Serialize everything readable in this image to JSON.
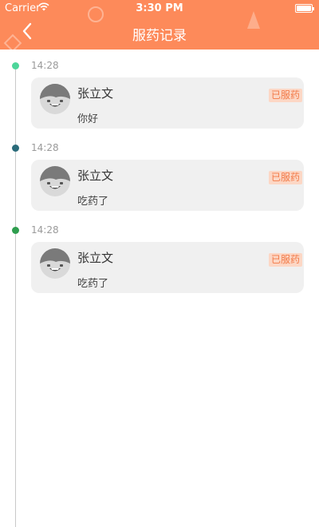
{
  "status_bar": {
    "carrier": "Carrier",
    "time": "3:30 PM",
    "battery_level": 1.0
  },
  "header": {
    "title": "服药记录",
    "back_icon": "chevron-left-icon"
  },
  "colors": {
    "header": "#fd8a5a",
    "badge_bg": "#fcd7c5",
    "badge_text": "#f27a48",
    "card_bg": "#f0f0f0"
  },
  "records": [
    {
      "time": "14:28",
      "name": "张立文",
      "message": "你好",
      "status": "已服药",
      "dot_color": "#4dd69a"
    },
    {
      "time": "14:28",
      "name": "张立文",
      "message": "吃药了",
      "status": "已服药",
      "dot_color": "#2a6b7a"
    },
    {
      "time": "14:28",
      "name": "张立文",
      "message": "吃药了",
      "status": "已服药",
      "dot_color": "#2e9d4e"
    }
  ]
}
